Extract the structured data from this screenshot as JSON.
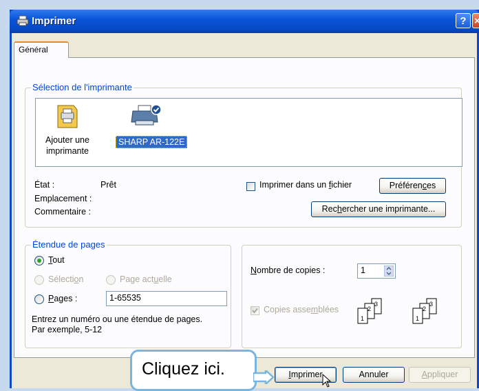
{
  "window": {
    "title": "Imprimer",
    "help": "?",
    "close": "×"
  },
  "tabs": [
    {
      "label": "Général"
    }
  ],
  "printer_selection": {
    "label": "Sélection de l'imprimante",
    "items": [
      {
        "label_line1": "Ajouter une",
        "label_line2": "imprimante"
      },
      {
        "label": "SHARP AR-122E"
      }
    ],
    "status_label": "État :",
    "status_value": "Prêt",
    "location_label": "Emplacement :",
    "comment_label": "Commentaire :",
    "print_to_file_pre": "Imprimer dans un ",
    "print_to_file_u": "f",
    "print_to_file_post": "ichier",
    "preferences_pre": "Préféren",
    "preferences_u": "c",
    "preferences_post": "es",
    "find_printer_pre": "Rec",
    "find_printer_u": "h",
    "find_printer_post": "ercher une imprimante..."
  },
  "page_range": {
    "label": "Étendue de pages",
    "all_u": "T",
    "all_post": "out",
    "selection_pre": "Sélecti",
    "selection_u": "o",
    "selection_post": "n",
    "current_pre": "Page act",
    "current_u": "u",
    "current_post": "elle",
    "pages_u": "P",
    "pages_post": "ages :",
    "pages_value": "1-65535",
    "hint_line1": "Entrez un numéro ou une étendue de pages.",
    "hint_line2": "Par exemple, 5-12"
  },
  "copies": {
    "count_u": "N",
    "count_post": "ombre de copies :",
    "count_value": "1",
    "collate_pre": "Copies asse",
    "collate_u": "m",
    "collate_post": "blées",
    "collate_checked": true
  },
  "footer": {
    "print_u": "I",
    "print_post": "mprimer",
    "cancel": "Annuler",
    "apply_u": "A",
    "apply_post": "ppliquer"
  },
  "callout": {
    "text": "Cliquez ici."
  },
  "colors": {
    "titlebar": "#0a55d9",
    "groupbox_label": "#0046d5",
    "callout_border": "#7ab5de",
    "selection": "#316ac5"
  }
}
